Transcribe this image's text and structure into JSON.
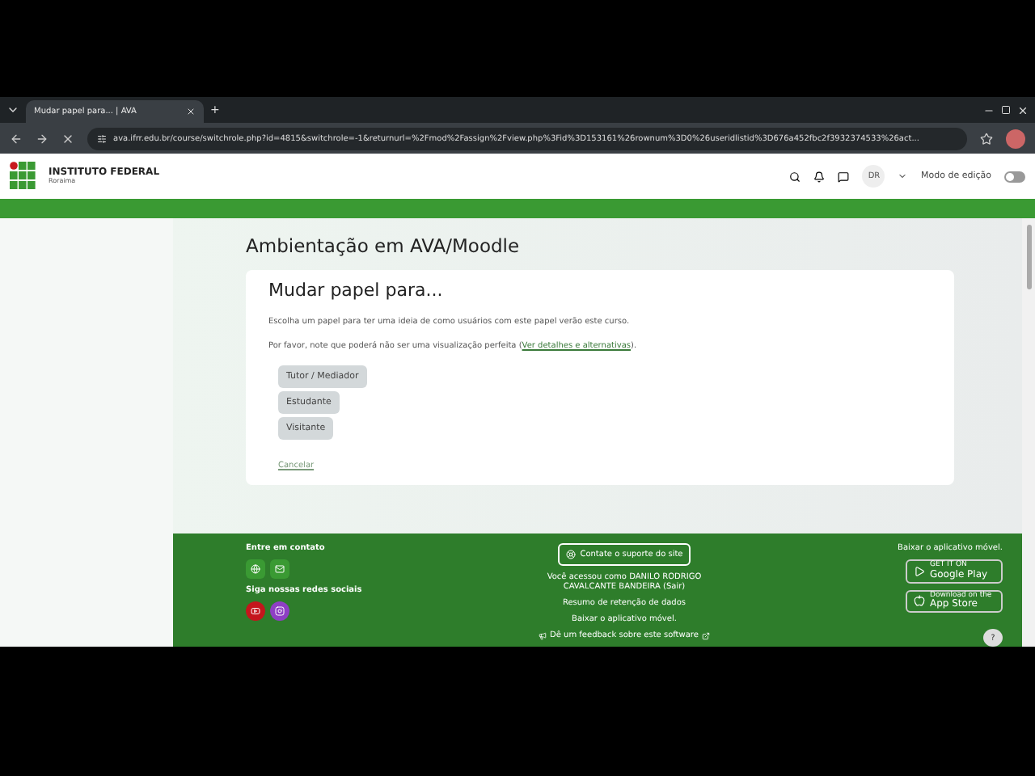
{
  "browser": {
    "tabs": [
      {
        "title": "Mudar papel para... | AVA",
        "selected": true
      }
    ],
    "new_tab": "+",
    "url": "ava.ifrr.edu.br/course/switchrole.php?id=4815&switchrole=-1&returnurl=%2Fmod%2Fassign%2Fview.php%3Fid%3D153161%26rownum%3D0%26useridlistid%3D676a452fbc2f3932374533%26act..."
  },
  "header": {
    "logo_title": "INSTITUTO FEDERAL",
    "logo_subtitle": "Roraima",
    "avatar": "DR",
    "edit_mode": {
      "label": "Modo de edição",
      "on": false
    }
  },
  "page": {
    "course_title": "Ambientação em AVA/Moodle",
    "card_title": "Mudar papel para...",
    "intro": "Escolha um papel para ter uma ideia de como usuários com este papel verão este curso.",
    "note": "Por favor, note que poderá não ser uma visualização perfeita (",
    "note_link": "Ver detalhes e alternativas",
    "note_end": ").",
    "roles": [
      "Tutor / Mediador",
      "Estudante",
      "Visitante"
    ],
    "cancel": "Cancelar"
  },
  "footer": {
    "contact_title": "Entre em contato",
    "social_title": "Siga nossas redes sociais",
    "social": [
      {
        "color": "#c4161c"
      },
      {
        "color": "#8e3fc4"
      }
    ],
    "support_button": "Contate o suporte do site",
    "logged_in": "Você acessou como DANILO RODRIGO CAVALCANTE BANDEIRA (Sair)",
    "retention": "Resumo de retenção de dados",
    "app_link": "Baixar o aplicativo móvel.",
    "feedback": "Dê um feedback sobre este software",
    "app_title": "Baixar o aplicativo móvel.",
    "google_play": {
      "small": "GET IT ON",
      "big": "Google Play"
    },
    "app_store": {
      "small": "Download on the",
      "big": "App Store"
    },
    "help": "?"
  }
}
